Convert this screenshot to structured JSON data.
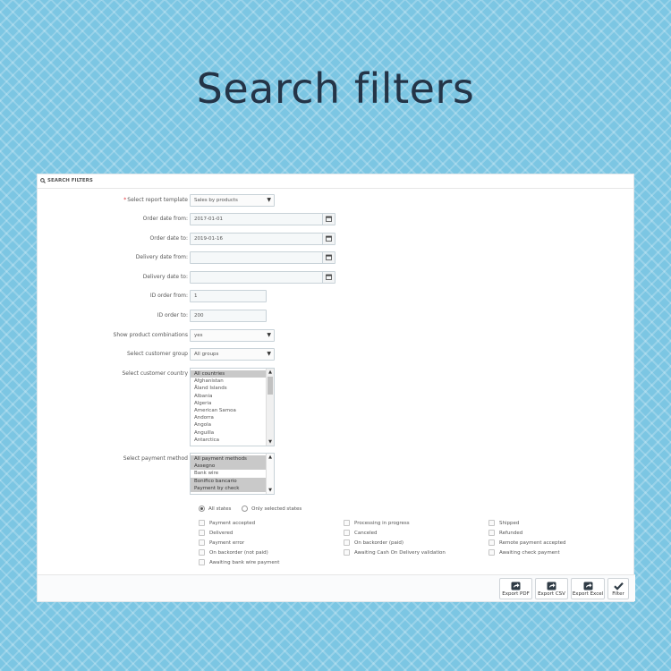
{
  "page_title": "Search filters",
  "panel": {
    "header": "SEARCH FILTERS",
    "header_icon": "search-icon"
  },
  "fields": {
    "report_template": {
      "label": "Select report template",
      "required": true,
      "value": "Sales by products"
    },
    "order_date_from": {
      "label": "Order date from:",
      "value": "2017-01-01"
    },
    "order_date_to": {
      "label": "Order date to:",
      "value": "2019-01-16"
    },
    "delivery_date_from": {
      "label": "Delivery date from:",
      "value": ""
    },
    "delivery_date_to": {
      "label": "Delivery date to:",
      "value": ""
    },
    "id_order_from": {
      "label": "ID order from:",
      "value": "1"
    },
    "id_order_to": {
      "label": "ID order to:",
      "value": "200"
    },
    "show_combinations": {
      "label": "Show product combinations",
      "value": "yes"
    },
    "customer_group": {
      "label": "Select customer group",
      "value": "All groups"
    },
    "customer_country": {
      "label": "Select customer country",
      "options": [
        "All countries",
        "Afghanistan",
        "Åland Islands",
        "Albania",
        "Algeria",
        "American Samoa",
        "Andorra",
        "Angola",
        "Anguilla",
        "Antarctica"
      ],
      "selected": [
        "All countries"
      ]
    },
    "payment_method": {
      "label": "Select payment method",
      "options": [
        "All payment methods",
        "Assegno",
        "Bank wire",
        "Bonifico bancario",
        "Payment by check"
      ],
      "selected": [
        "All payment methods",
        "Assegno",
        "Bonifico bancario",
        "Payment by check"
      ]
    }
  },
  "states_mode": {
    "all_label": "All states",
    "only_label": "Only selected states",
    "selected": "all"
  },
  "states": [
    [
      "Payment accepted",
      "Processing in progress",
      "Shipped"
    ],
    [
      "Delivered",
      "Canceled",
      "Refunded"
    ],
    [
      "Payment error",
      "On backorder (paid)",
      "Remote payment accepted"
    ],
    [
      "On backorder (not paid)",
      "Awaiting Cash On Delivery validation",
      "Awaiting check payment"
    ],
    [
      "Awaiting bank wire payment"
    ]
  ],
  "buttons": [
    {
      "label": "Export PDF",
      "icon": "export-icon"
    },
    {
      "label": "Export CSV",
      "icon": "export-icon"
    },
    {
      "label": "Export Excel",
      "icon": "export-icon"
    },
    {
      "label": "Filter",
      "icon": "checkmark-icon"
    }
  ]
}
